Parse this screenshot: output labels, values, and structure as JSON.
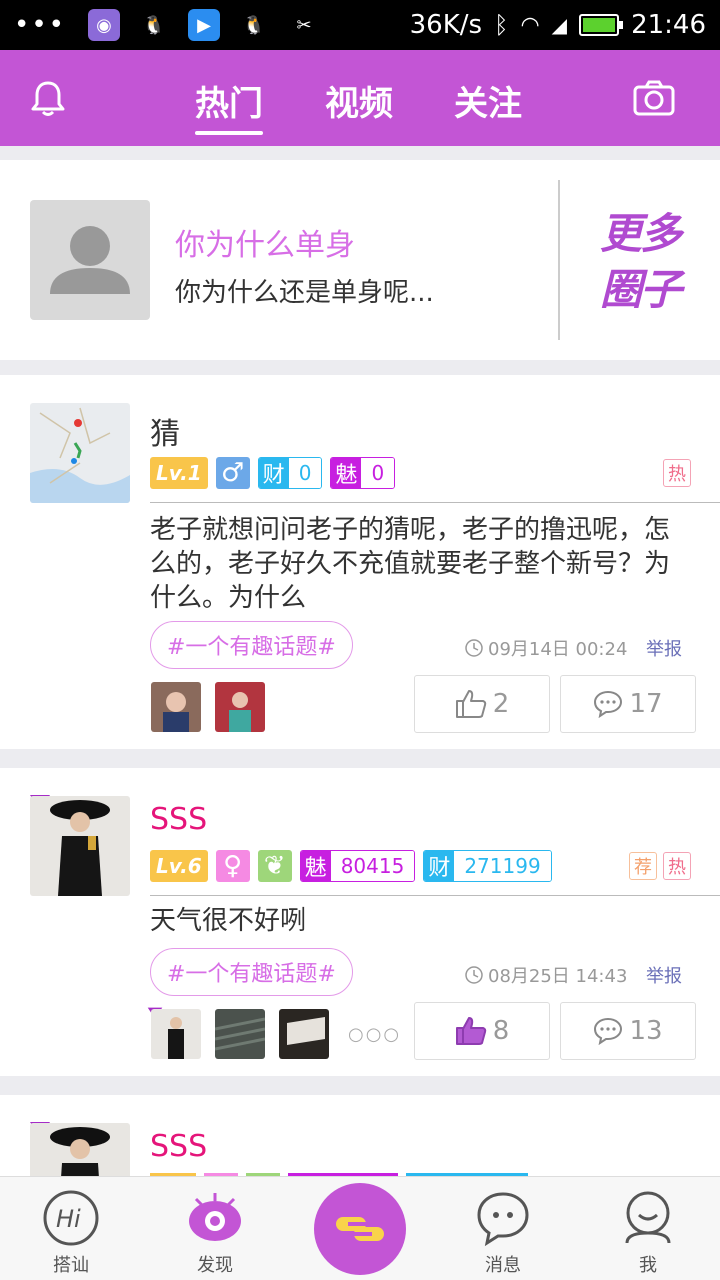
{
  "status_bar": {
    "dots": "•••",
    "speed": "36K/s",
    "time": "21:46"
  },
  "topnav": {
    "tabs": [
      {
        "label": "热门",
        "active": true
      },
      {
        "label": "视频",
        "active": false
      },
      {
        "label": "关注",
        "active": false
      }
    ]
  },
  "banner": {
    "title": "你为什么单身",
    "desc": "你为什么还是单身呢...",
    "more_line1": "更多",
    "more_line2": "圈子"
  },
  "posts": [
    {
      "name": "猜",
      "level": "Lv.1",
      "gender_icon": "male-icon",
      "cai_key": "财",
      "cai_val": "0",
      "mei_key": "魅",
      "mei_val": "0",
      "tags": [
        "热"
      ],
      "text": "老子就想问问老子的猜呢，老子的撸迅呢，怎么的，老子好久不充值就要老子整个新号？为什么。为什么",
      "topic": "#一个有趣话题#",
      "time": "09月14日 00:24",
      "report": "举报",
      "likes": "2",
      "comments": "17"
    },
    {
      "name": "SSS",
      "level": "Lv.6",
      "gender_icon": "female-icon",
      "mei_key": "魅",
      "mei_val": "80415",
      "cai_key": "财",
      "cai_val": "271199",
      "tags": [
        "荐",
        "热"
      ],
      "text": "天气很不好咧",
      "topic": "#一个有趣话题#",
      "time": "08月25日 14:43",
      "report": "举报",
      "likes": "8",
      "comments": "13",
      "more": "○○○"
    },
    {
      "name": "SSS"
    }
  ],
  "tabbar": {
    "items": [
      {
        "label": "搭讪",
        "icon": "hi-icon"
      },
      {
        "label": "发现",
        "icon": "eye-icon"
      },
      {
        "label": "消息",
        "icon": "chat-icon"
      },
      {
        "label": "我",
        "icon": "profile-icon"
      }
    ]
  },
  "colors": {
    "brand": "#c355d5",
    "accent_pink": "#d76ee6",
    "blue": "#2ab8ef"
  }
}
